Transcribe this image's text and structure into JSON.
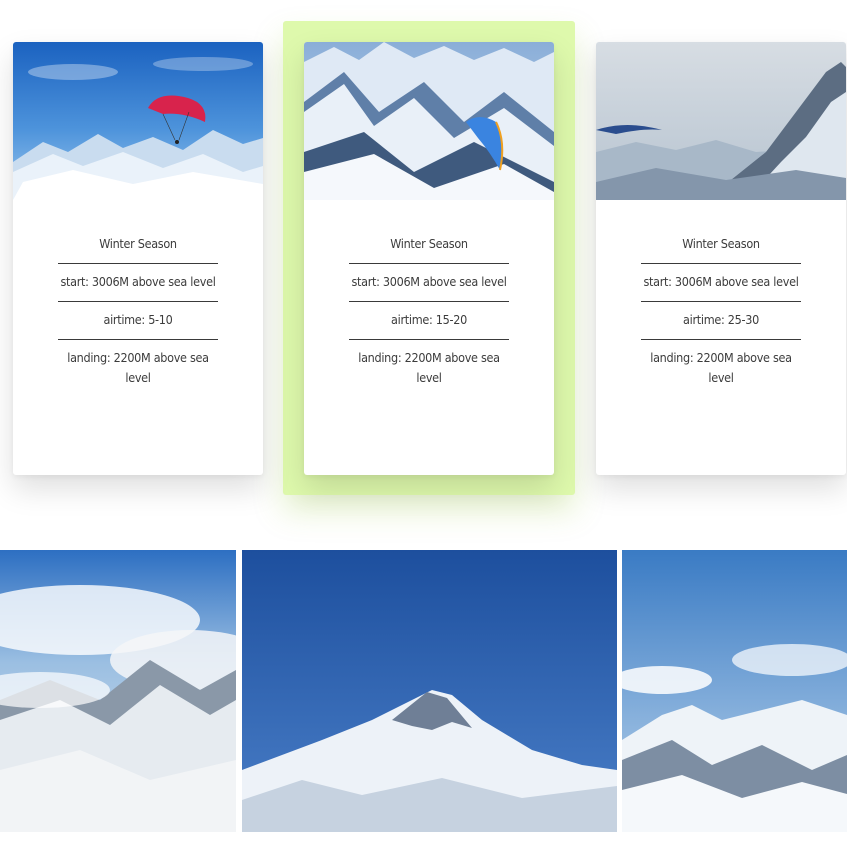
{
  "cards": [
    {
      "image": "paraglider-red-over-snowy-peaks",
      "season": "Winter Season",
      "start": "start: 3006M above sea level",
      "airtime": "airtime: 5-10",
      "landing": "landing: 2200M above sea level",
      "highlighted": false
    },
    {
      "image": "paraglider-blue-over-snowy-range",
      "season": "Winter Season",
      "start": "start: 3006M above sea level",
      "airtime": "airtime: 15-20",
      "landing": "landing: 2200M above sea level",
      "highlighted": true
    },
    {
      "image": "paraglider-over-misty-mountains",
      "season": "Winter Season",
      "start": "start: 3006M above sea level",
      "airtime": "airtime: 25-30",
      "landing": "landing: 2200M above sea level",
      "highlighted": false
    }
  ],
  "gallery": [
    {
      "image": "snowy-slopes-with-clouds"
    },
    {
      "image": "snow-peak-under-blue-sky"
    },
    {
      "image": "snowy-ridges-with-clouds"
    }
  ],
  "colors": {
    "highlight": "#def9ac",
    "text": "#3a3a3a",
    "sky_blue": "#2d63b8",
    "snow": "#eef3f8"
  }
}
